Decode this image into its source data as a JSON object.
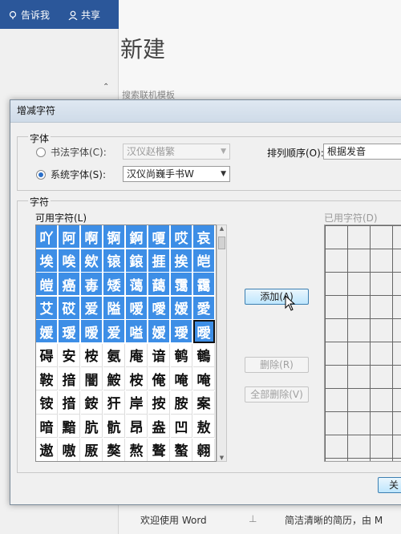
{
  "word": {
    "tell_me": "告诉我",
    "share": "共享",
    "new_title": "新建",
    "search_placeholder": "搜索联机模板",
    "welcome": "欢迎使用 Word",
    "resume_tip": "简洁清晰的简历，由 M"
  },
  "dialog": {
    "title": "增减字符",
    "font_group": "字体",
    "calligraphy_font_label": "书法字体(C):",
    "calligraphy_font_value": "汉仪赵楷繁",
    "system_font_label": "系统字体(S):",
    "system_font_value": "汉仪尚巍手书W",
    "sort_label": "排列顺序(O):",
    "sort_value": "根据发音",
    "chars_group": "字符",
    "available_label": "可用字符(L)",
    "used_label": "已用字符(D)",
    "add_button": "添加(A)",
    "remove_button": "删除(R)",
    "remove_all_button": "全部删除(V)",
    "close_button": "关"
  },
  "available_chars": [
    [
      "吖",
      "阿",
      "啊",
      "锕",
      "錒",
      "嗄",
      "哎",
      "哀"
    ],
    [
      "埃",
      "唉",
      "欸",
      "锿",
      "鎄",
      "捱",
      "挨",
      "皑"
    ],
    [
      "皚",
      "癌",
      "毐",
      "矮",
      "蔼",
      "藹",
      "霭",
      "靄"
    ],
    [
      "艾",
      "砹",
      "爱",
      "隘",
      "嗳",
      "噯",
      "嫒",
      "愛"
    ],
    [
      "媛",
      "瑷",
      "暧",
      "爱",
      "嗌",
      "嫒",
      "璦",
      "曖"
    ],
    [
      "碍",
      "安",
      "桉",
      "氨",
      "庵",
      "谙",
      "鹌",
      "鵪"
    ],
    [
      "鞍",
      "揞",
      "闇",
      "鮟",
      "桉",
      "俺",
      "唵",
      "唵"
    ],
    [
      "铵",
      "揞",
      "銨",
      "犴",
      "岸",
      "按",
      "胺",
      "案"
    ],
    [
      "暗",
      "黯",
      "肮",
      "骯",
      "昂",
      "盎",
      "凹",
      "敖"
    ],
    [
      "遨",
      "嗷",
      "厫",
      "獒",
      "熬",
      "聱",
      "螯",
      "翱"
    ]
  ],
  "selected_rows": 5,
  "focused_cell": "4,7"
}
